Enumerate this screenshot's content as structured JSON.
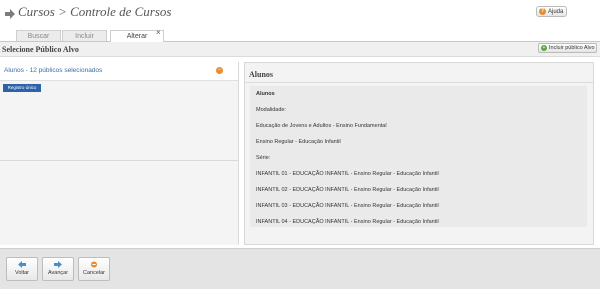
{
  "header": {
    "title": "Cursos > Controle de Cursos",
    "help_label": "Ajuda",
    "help_icon": "help-icon"
  },
  "tabs": [
    {
      "label": "Buscar",
      "active": false
    },
    {
      "label": "Incluir",
      "active": false
    },
    {
      "label": "Alterar",
      "active": true
    }
  ],
  "tab_close_glyph": "×",
  "section": {
    "title": "Selecione Público Alvo",
    "add_label": "Incluir público Alvo"
  },
  "left": {
    "row_label": "Alunos - 12 públicos selecionados",
    "badge": "Registro único"
  },
  "right": {
    "title": "Alunos",
    "lines": [
      "Alunos",
      "Modalidade:",
      "Educação de Jovens e Adultos - Ensino Fundamental",
      "Ensino Regular - Educação Infantil",
      "Série:",
      "INFANTIL 01 - EDUCAÇÃO INFANTIL - Ensino Regular - Educação Infantil",
      "INFANTIL 02 - EDUCAÇÃO INFANTIL - Ensino Regular - Educação Infantil",
      "INFANTIL 03 - EDUCAÇÃO INFANTIL - Ensino Regular - Educação Infantil",
      "INFANTIL 04 - EDUCAÇÃO INFANTIL - Ensino Regular - Educação Infantil"
    ]
  },
  "footer": {
    "back_label": "Voltar",
    "next_label": "Avançar",
    "cancel_label": "Cancelar"
  },
  "colors": {
    "accent_orange": "#e98c2a",
    "add_green": "#5aa63a",
    "badge_blue": "#2b62a8",
    "nav_blue": "#4a90c8"
  }
}
